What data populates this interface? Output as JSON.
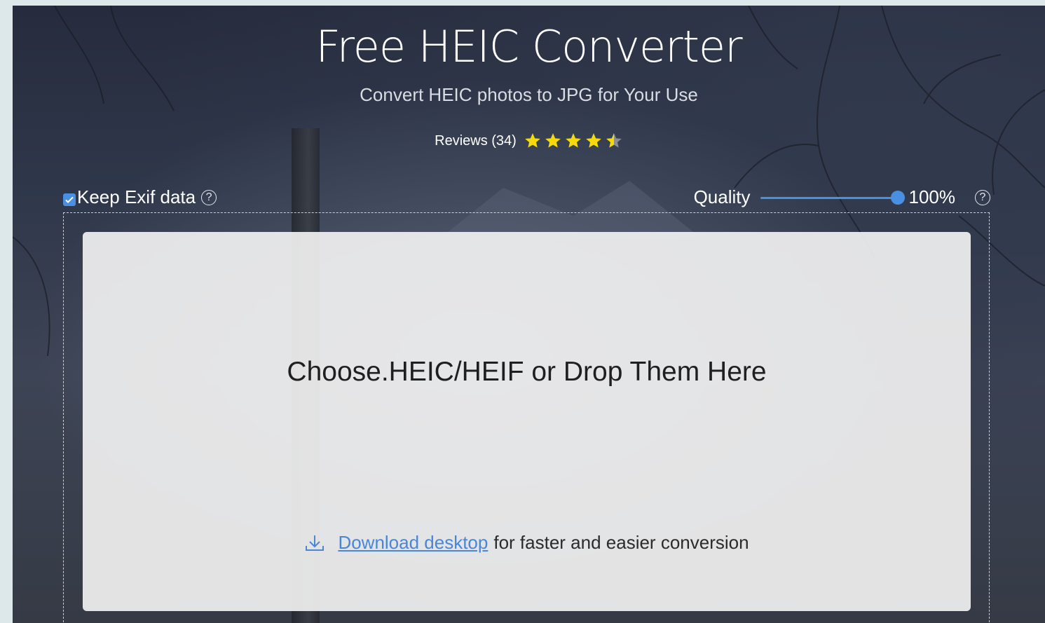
{
  "header": {
    "title": "Free HEIC Converter",
    "subtitle": "Convert HEIC photos to JPG for Your Use"
  },
  "reviews": {
    "label": "Reviews (34)",
    "rating": 4.5,
    "max_rating": 5,
    "star_color": "#f5d90a"
  },
  "options": {
    "keep_exif_label": "Keep Exif data",
    "keep_exif_checked": true,
    "quality_label": "Quality",
    "quality_value": "100%",
    "quality_level": 1.0
  },
  "dropzone": {
    "prompt": "Choose.HEIC/HEIF or Drop Them Here",
    "download_link": "Download desktop",
    "download_suffix": "for faster and easier conversion"
  },
  "icons": {
    "help": "question-circle-icon",
    "download": "download-icon",
    "check": "check-icon",
    "star": "star-icon"
  },
  "colors": {
    "accent": "#4a90e2",
    "link": "#4a86d8"
  }
}
